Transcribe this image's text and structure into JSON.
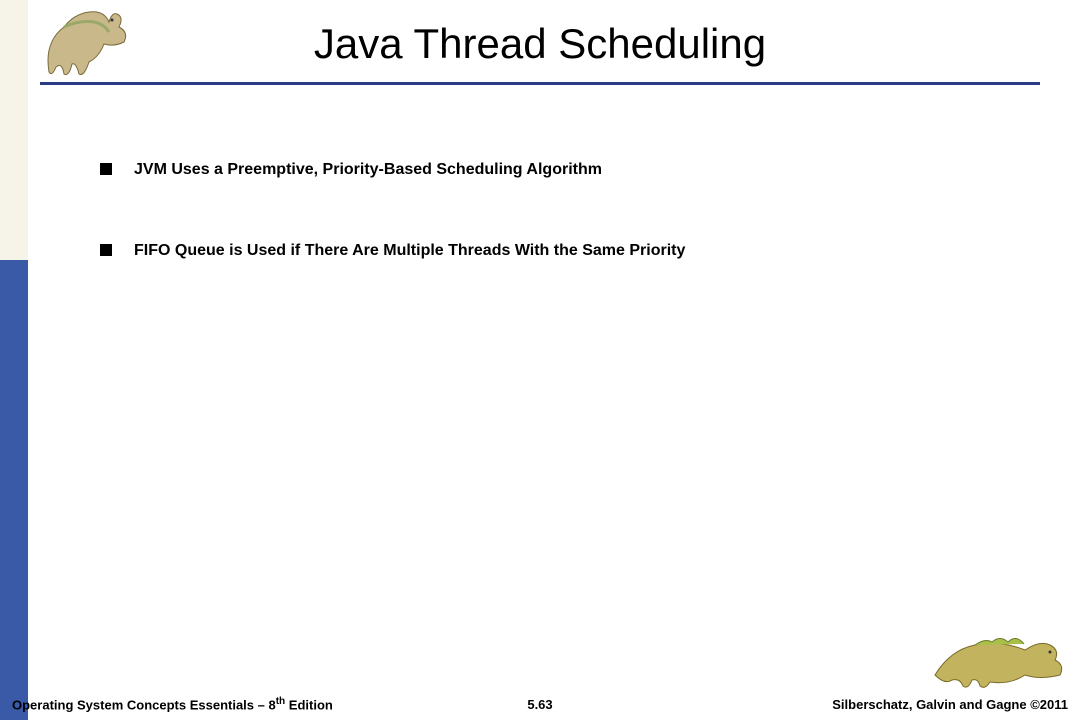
{
  "title": "Java Thread Scheduling",
  "bullets": [
    "JVM Uses a Preemptive, Priority-Based Scheduling Algorithm",
    "FIFO Queue is Used if There Are Multiple Threads With the Same Priority"
  ],
  "footer": {
    "left_prefix": "Operating System Concepts Essentials – 8",
    "left_suffix": " Edition",
    "left_sup": "th",
    "center": "5.63",
    "right": "Silberschatz, Galvin and Gagne ©2011"
  },
  "colors": {
    "rule": "#2a3a85",
    "sidebar_top": "#f6f3e8",
    "sidebar_bottom": "#3a5aa8"
  }
}
